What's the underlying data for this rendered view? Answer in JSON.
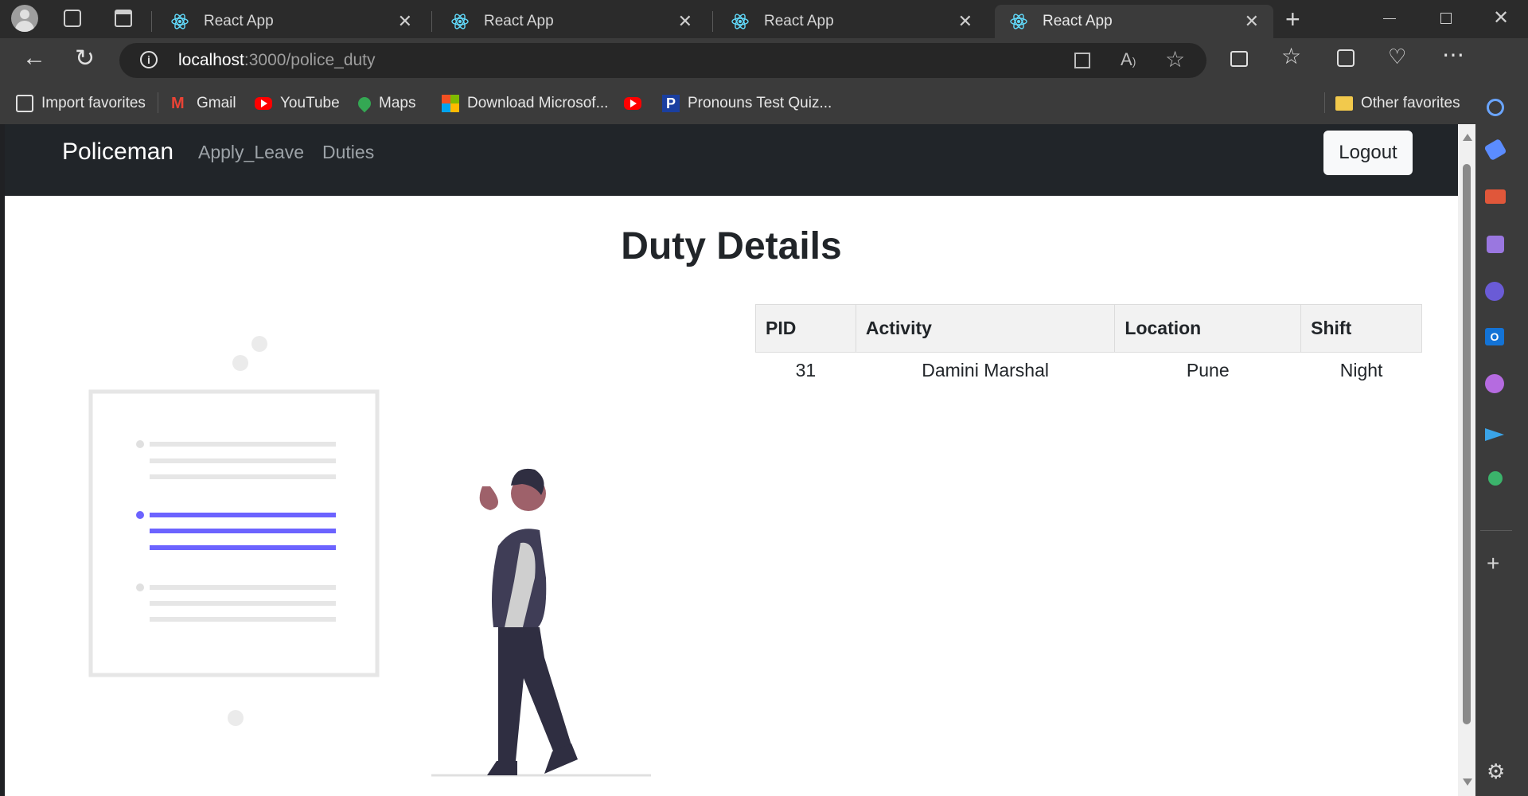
{
  "browser": {
    "tabs": [
      {
        "label": "React App"
      },
      {
        "label": "React App"
      },
      {
        "label": "React App"
      },
      {
        "label": "React App"
      }
    ],
    "address": {
      "host": "localhost",
      "path": ":3000/police_duty"
    },
    "bookmarks": [
      {
        "label": "Import favorites",
        "icon": "import-icon"
      },
      {
        "label": "Gmail",
        "icon": "gmail-icon"
      },
      {
        "label": "YouTube",
        "icon": "youtube-icon"
      },
      {
        "label": "Maps",
        "icon": "maps-icon"
      },
      {
        "label": "Download Microsof...",
        "icon": "microsoft-icon"
      },
      {
        "label": "Pronouns Test Quiz...",
        "icon": "pronouns-icon"
      }
    ],
    "other_favorites": "Other favorites"
  },
  "navbar": {
    "brand": "Policeman",
    "links": [
      "Apply_Leave",
      "Duties"
    ],
    "logout": "Logout"
  },
  "page": {
    "title": "Duty Details",
    "table": {
      "headers": [
        "PID",
        "Activity",
        "Location",
        "Shift"
      ],
      "rows": [
        [
          "31",
          "Damini Marshal",
          "Pune",
          "Night"
        ]
      ]
    }
  },
  "colors": {
    "navbar_bg": "#212529",
    "accent_illustration": "#6c63ff",
    "browser_chrome": "#3b3b3b"
  }
}
